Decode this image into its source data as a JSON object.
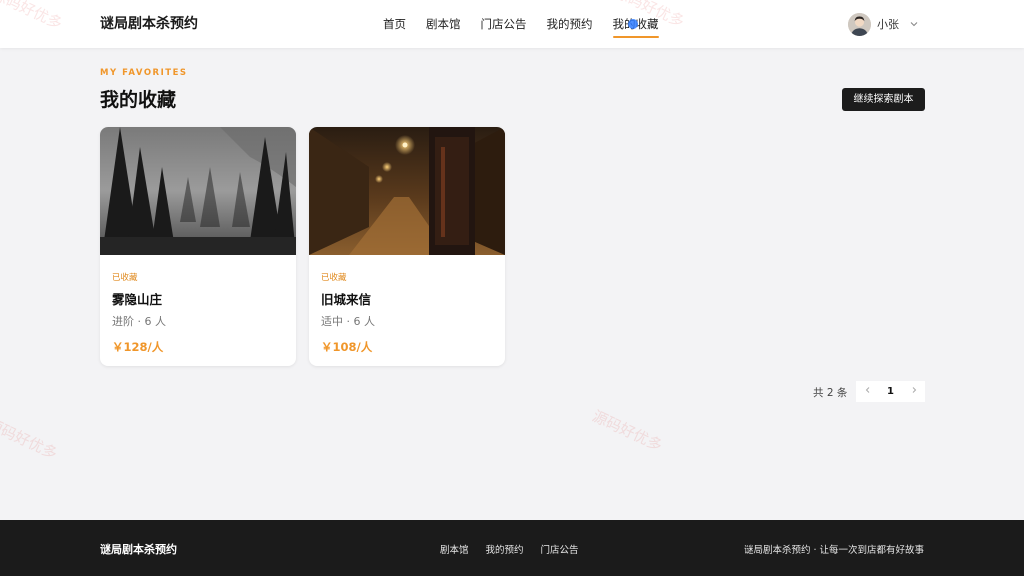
{
  "header": {
    "brand": "谜局剧本杀预约",
    "nav": [
      {
        "label": "首页"
      },
      {
        "label": "剧本馆"
      },
      {
        "label": "门店公告"
      },
      {
        "label": "我的预约"
      },
      {
        "label": "我的收藏"
      }
    ],
    "active_nav": "我的收藏",
    "user": {
      "name": "小张"
    }
  },
  "page": {
    "eyebrow": "MY FAVORITES",
    "title": "我的收藏",
    "explore_button": "继续探索剧本"
  },
  "favorites": [
    {
      "tag": "已收藏",
      "title": "雾隐山庄",
      "meta": "进阶 · 6 人",
      "price": "￥128/人",
      "image": "misty-pine-forest"
    },
    {
      "tag": "已收藏",
      "title": "旧城来信",
      "meta": "适中 · 6 人",
      "price": "￥108/人",
      "image": "rainy-old-street-night"
    }
  ],
  "pagination": {
    "total": "共 2 条",
    "prev_icon": "chevron-left-icon",
    "current": "1",
    "next_icon": "chevron-right-icon"
  },
  "watermark": "源码好优多",
  "footer": {
    "brand": "谜局剧本杀预约",
    "links": [
      {
        "label": "剧本馆"
      },
      {
        "label": "我的预约"
      },
      {
        "label": "门店公告"
      }
    ],
    "slogan": "谜局剧本杀预约 · 让每一次到店都有好故事"
  },
  "colors": {
    "accent": "#f0962a",
    "background": "#f3f3f5",
    "dark": "#1b1b1b"
  }
}
